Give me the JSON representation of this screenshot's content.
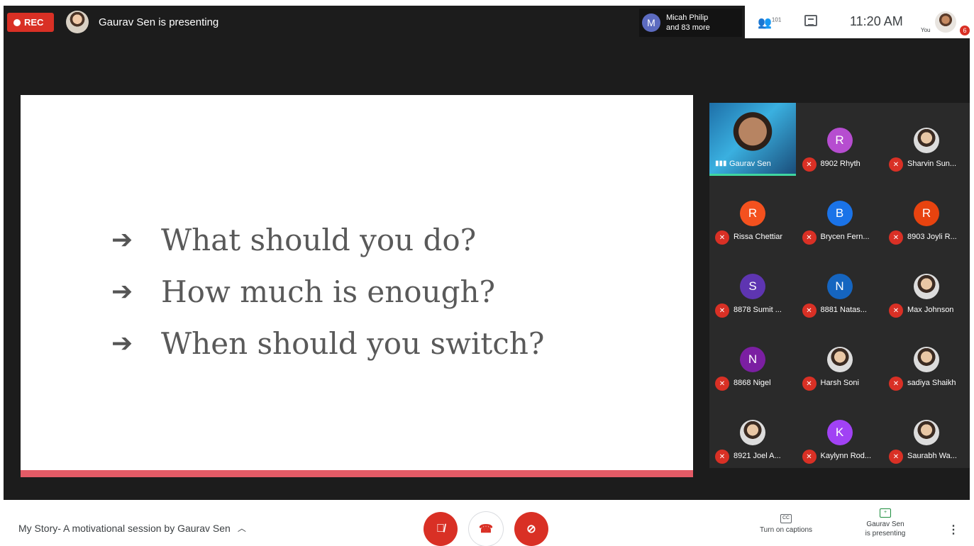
{
  "top_bar": {
    "rec_label": "REC",
    "presenting_text": "Gaurav Sen is presenting",
    "participant_chip": {
      "initial": "M",
      "line1": "Micah Philip",
      "line2": "and 83 more"
    },
    "people_count": "101",
    "time": "11:20 AM",
    "self_label": "You",
    "notification_count": "6"
  },
  "slide": {
    "bullets": [
      {
        "arrow": "➔",
        "text": "What should you do?"
      },
      {
        "arrow": "➔",
        "text": "How much is enough?"
      },
      {
        "arrow": "➔",
        "text": "When should you switch?"
      }
    ],
    "accent_color": "#e35b66"
  },
  "participants": [
    {
      "name": "Gaurav Sen",
      "type": "speaker"
    },
    {
      "name": "8902 Rhyth",
      "initial": "R",
      "color": "#b64dd0"
    },
    {
      "name": "Sharvin Sun...",
      "type": "photo"
    },
    {
      "name": "Rissa Chettiar",
      "initial": "R",
      "color": "#f4511e"
    },
    {
      "name": "Brycen Fern...",
      "initial": "B",
      "color": "#1a73e8"
    },
    {
      "name": "8903 Joyli R...",
      "initial": "R",
      "color": "#e8430f"
    },
    {
      "name": "8878 Sumit ...",
      "initial": "S",
      "color": "#5e35b1"
    },
    {
      "name": "8881 Natas...",
      "initial": "N",
      "color": "#1565c0"
    },
    {
      "name": "Max Johnson",
      "type": "photo"
    },
    {
      "name": "8868 Nigel",
      "initial": "N",
      "color": "#7b1fa2"
    },
    {
      "name": "Harsh Soni",
      "type": "photo"
    },
    {
      "name": "sadiya Shaikh",
      "type": "photo"
    },
    {
      "name": "8921 Joel A...",
      "type": "photo"
    },
    {
      "name": "Kaylynn Rod...",
      "initial": "K",
      "color": "#a142f4"
    },
    {
      "name": "Saurabh Wa...",
      "type": "photo"
    }
  ],
  "bottom_bar": {
    "meeting_title": "My Story- A motivational session by Gaurav Sen",
    "captions_label": "Turn on captions",
    "presenting_label_1": "Gaurav Sen",
    "presenting_label_2": "is presenting",
    "cc_icon_text": "CC"
  },
  "icons": {
    "mic_off": "mic-off-icon",
    "hang_up": "phone-hangup-icon",
    "cam_off": "camera-off-icon",
    "people": "people-icon",
    "chat": "chat-icon",
    "more": "more-vert-icon"
  },
  "colors": {
    "red": "#d93025",
    "dark_bg": "#1c1c1c",
    "tile_bg": "#2a2a2a"
  }
}
